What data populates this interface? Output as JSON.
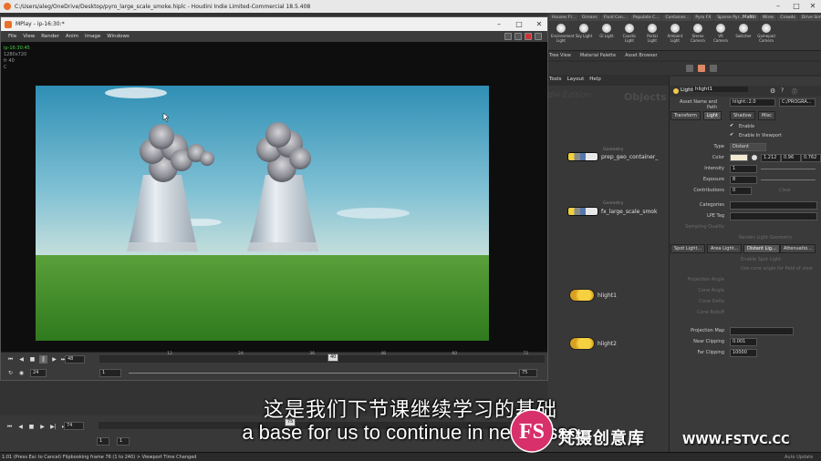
{
  "main_window": {
    "title": "C:/Users/aleg/OneDrive/Desktop/pyro_large_scale_smoke.hiplc - Houdini Indie Limited-Commercial 18.5.408"
  },
  "shelf": {
    "tabs": [
      "Houses Fl...",
      "Oceans",
      "Fluid Con...",
      "Populate C...",
      "Container...",
      "Pyro FX",
      "Sparse Pyr...",
      "RBI",
      "Wires",
      "Crowds",
      "Drive Sim..."
    ],
    "tools": [
      "Environment Light",
      "Sky Light",
      "GI Light",
      "Caustic Light",
      "Portal Light",
      "Ambient Light",
      "Stereo Camera",
      "VR Camera",
      "Switcher",
      "Gamepad Camera"
    ],
    "desktop_label": "Main"
  },
  "mplay": {
    "title": "MPlay - ip-16:30:*",
    "menu": [
      "File",
      "View",
      "Render",
      "Anim",
      "Image",
      "Windows"
    ],
    "info_lines": [
      "ip-16:30:45",
      "1280x720",
      "fr 40",
      "C"
    ],
    "frame_field": "48",
    "current_frame_marker": "40",
    "fps_field": "24",
    "range_start": "1",
    "range_end": "75",
    "ticks": [
      "12",
      "24",
      "36",
      "48",
      "60",
      "72"
    ]
  },
  "network": {
    "header_items": [
      "Tree View",
      "Material Palette",
      "Asset Browser"
    ],
    "menu": [
      "Tools",
      "Layout",
      "Help"
    ],
    "watermark_left": "Indie Edition",
    "watermark_right": "Objects",
    "nodes": [
      {
        "type": "Geometry",
        "name": "prep_geo_container_"
      },
      {
        "type": "Geometry",
        "name": "fx_large_scale_smok"
      },
      {
        "type": "",
        "name": "hlight1"
      },
      {
        "type": "",
        "name": "hlight2"
      }
    ]
  },
  "params": {
    "node_type": "Light",
    "node_name": "hlight1",
    "asset_label": "Asset Name and Path",
    "asset_value": "hlight::2.0",
    "asset_path": "C:/PROGRA...",
    "tabs": [
      "Transform",
      "Light",
      "Shadow",
      "Misc"
    ],
    "enable_label": "Enable",
    "enable_viewport_label": "Enable In Viewport",
    "type_label": "Type",
    "type_value": "Distant",
    "color_label": "Color",
    "color_values": [
      "1.212",
      "0.96",
      "0.762"
    ],
    "intensity_label": "Intensity",
    "intensity_value": "1",
    "exposure_label": "Exposure",
    "exposure_value": "8",
    "contributions_label": "Contributions",
    "contributions_value": "0",
    "contributions_clear": "Clear",
    "categories_label": "Categories",
    "lpe_label": "LPE Tag",
    "sampling_label": "Sampling Quality",
    "render_geo_label": "Render Light Geometry",
    "subtabs": [
      "Spot Light...",
      "Area Light...",
      "Distant Lig...",
      "Attenuatio..."
    ],
    "enable_spot": "Enable Spot Light",
    "use_cone": "Use cone angle for field of view",
    "projection_angle": "Projection Angle",
    "cone_angle": "Cone Angle",
    "cone_delta": "Cone Delta",
    "cone_rolloff": "Cone Rolloff",
    "projection_map": "Projection Map",
    "near_clip_label": "Near Clipping",
    "near_clip_value": "0.001",
    "far_clip_label": "Far Clipping",
    "far_clip_value": "10000"
  },
  "houdini_playbar": {
    "frame_field": "74",
    "fps_field": "1",
    "range_start": "1",
    "current_frame": "75",
    "marker": "1"
  },
  "status": {
    "text": "1:01 (Press Esc to Cancel) Flipbooking frame 76 (1 to 240) > Viewport Time Changed",
    "right": "Auto Update"
  },
  "subtitles": {
    "cn": "这是我们下节课继续学习的基础",
    "en": "a base for us to continue in next lesso"
  },
  "watermark": {
    "logo_letters": "FS",
    "cn": "梵摄创意库",
    "url": "WWW.FSTVC.CC"
  }
}
